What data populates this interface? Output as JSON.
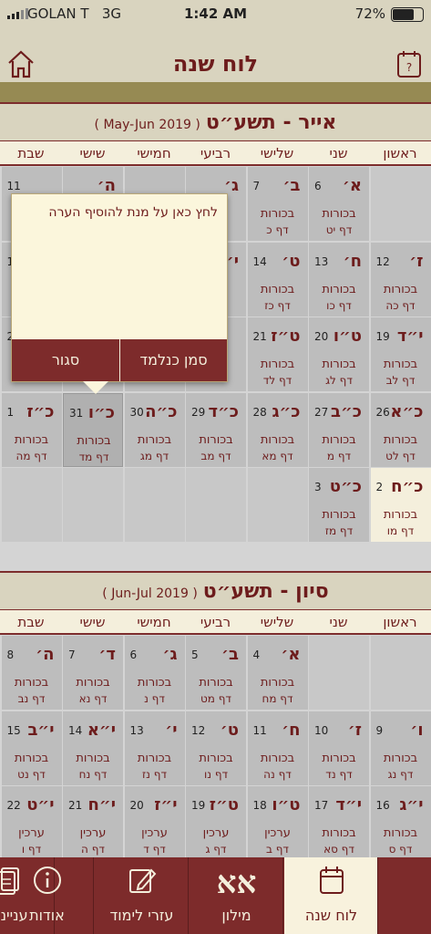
{
  "status": {
    "carrier": "GOLAN T",
    "network": "3G",
    "time": "1:42 AM",
    "battery": "72%"
  },
  "nav": {
    "title": "לוח שנה"
  },
  "weekdays": [
    "ראשון",
    "שני",
    "שלישי",
    "רביעי",
    "חמישי",
    "שישי",
    "שבת"
  ],
  "popup": {
    "hint": "לחץ כאן על מנת להוסיף הערה",
    "mark_label": "סמן כנלמד",
    "close_label": "סגור"
  },
  "months": [
    {
      "hebrew": "אייר - תשע״ט",
      "gregorian": "( May-Jun 2019 )",
      "weeks": [
        [
          null,
          {
            "h": "א׳",
            "g": "6",
            "t": "בכורות",
            "d": "דף יט"
          },
          {
            "h": "ב׳",
            "g": "7",
            "t": "בכורות",
            "d": "דף כ"
          },
          {
            "h": "ג׳",
            "g": "",
            "t": "",
            "d": ""
          },
          {
            "h": "",
            "g": "",
            "t": "",
            "d": ""
          },
          {
            "h": "ה׳",
            "g": "",
            "t": "",
            "d": ""
          },
          {
            "h": "",
            "g": "11",
            "t": "",
            "d": ""
          }
        ],
        [
          {
            "h": "ז׳",
            "g": "12",
            "t": "בכורות",
            "d": "דף כה"
          },
          {
            "h": "ח׳",
            "g": "13",
            "t": "בכורות",
            "d": "דף כו"
          },
          {
            "h": "ט׳",
            "g": "14",
            "t": "בכורות",
            "d": "דף כז"
          },
          {
            "h": "י׳",
            "g": "",
            "t": "",
            "d": ""
          },
          {
            "h": "",
            "g": "",
            "t": "",
            "d": ""
          },
          {
            "h": "",
            "g": "",
            "t": "",
            "d": ""
          },
          {
            "h": "",
            "g": "1",
            "t": "",
            "d": ""
          }
        ],
        [
          {
            "h": "י״ד",
            "g": "19",
            "t": "בכורות",
            "d": "דף לב"
          },
          {
            "h": "ט״ו",
            "g": "20",
            "t": "בכורות",
            "d": "דף לג"
          },
          {
            "h": "ט״ז",
            "g": "21",
            "t": "בכורות",
            "d": "דף לד"
          },
          {
            "h": "",
            "g": "",
            "t": "",
            "d": ""
          },
          {
            "h": "",
            "g": "",
            "t": "",
            "d": ""
          },
          {
            "h": "",
            "g": "",
            "t": "",
            "d": ""
          },
          {
            "h": "",
            "g": "2",
            "t": "",
            "d": ""
          }
        ],
        [
          {
            "h": "כ״א",
            "g": "26",
            "t": "בכורות",
            "d": "דף לט"
          },
          {
            "h": "כ״ב",
            "g": "27",
            "t": "בכורות",
            "d": "דף מ"
          },
          {
            "h": "כ״ג",
            "g": "28",
            "t": "בכורות",
            "d": "דף מא"
          },
          {
            "h": "כ״ד",
            "g": "29",
            "t": "בכורות",
            "d": "דף מב"
          },
          {
            "h": "כ״ה",
            "g": "30",
            "t": "בכורות",
            "d": "דף מג"
          },
          {
            "h": "כ״ו",
            "g": "31",
            "t": "בכורות",
            "d": "דף מד",
            "sel": true
          },
          {
            "h": "כ״ז",
            "g": "1",
            "t": "בכורות",
            "d": "דף מה"
          }
        ],
        [
          {
            "h": "כ״ח",
            "g": "2",
            "t": "בכורות",
            "d": "דף מו",
            "today": true
          },
          {
            "h": "כ״ט",
            "g": "3",
            "t": "בכורות",
            "d": "דף מז"
          },
          null,
          null,
          null,
          null,
          null
        ]
      ]
    },
    {
      "hebrew": "סיון - תשע״ט",
      "gregorian": "( Jun-Jul 2019 )",
      "weeks": [
        [
          null,
          null,
          {
            "h": "א׳",
            "g": "4",
            "t": "בכורות",
            "d": "דף מח"
          },
          {
            "h": "ב׳",
            "g": "5",
            "t": "בכורות",
            "d": "דף מט"
          },
          {
            "h": "ג׳",
            "g": "6",
            "t": "בכורות",
            "d": "דף נ"
          },
          {
            "h": "ד׳",
            "g": "7",
            "t": "בכורות",
            "d": "דף נא"
          },
          {
            "h": "ה׳",
            "g": "8",
            "t": "בכורות",
            "d": "דף נב"
          }
        ],
        [
          {
            "h": "ו׳",
            "g": "9",
            "t": "בכורות",
            "d": "דף נג"
          },
          {
            "h": "ז׳",
            "g": "10",
            "t": "בכורות",
            "d": "דף נד"
          },
          {
            "h": "ח׳",
            "g": "11",
            "t": "בכורות",
            "d": "דף נה"
          },
          {
            "h": "ט׳",
            "g": "12",
            "t": "בכורות",
            "d": "דף נו"
          },
          {
            "h": "י׳",
            "g": "13",
            "t": "בכורות",
            "d": "דף נז"
          },
          {
            "h": "י״א",
            "g": "14",
            "t": "בכורות",
            "d": "דף נח"
          },
          {
            "h": "י״ב",
            "g": "15",
            "t": "בכורות",
            "d": "דף נט"
          }
        ],
        [
          {
            "h": "י״ג",
            "g": "16",
            "t": "בכורות",
            "d": "דף ס"
          },
          {
            "h": "י״ד",
            "g": "17",
            "t": "בכורות",
            "d": "דף סא"
          },
          {
            "h": "ט״ו",
            "g": "18",
            "t": "ערכין",
            "d": "דף ב"
          },
          {
            "h": "ט״ז",
            "g": "19",
            "t": "ערכין",
            "d": "דף ג"
          },
          {
            "h": "י״ז",
            "g": "20",
            "t": "ערכין",
            "d": "דף ד"
          },
          {
            "h": "י״ח",
            "g": "21",
            "t": "ערכין",
            "d": "דף ה"
          },
          {
            "h": "י״ט",
            "g": "22",
            "t": "ערכין",
            "d": "דף ו"
          }
        ]
      ]
    }
  ],
  "tabs": [
    {
      "label": "עניינים",
      "icon": "book-icon"
    },
    {
      "label": "לוח שנה",
      "icon": "calendar-icon",
      "active": true
    },
    {
      "label": "מילון",
      "icon": "alef-icon",
      "glyph": "אא"
    },
    {
      "label": "עזרי לימוד",
      "icon": "pencil-icon"
    },
    {
      "label": "אודות",
      "icon": "info-icon",
      "glyph": "i"
    }
  ],
  "colors": {
    "accent": "#7d2b2b",
    "cream": "#f4efdc",
    "gold": "#968a53",
    "cell": "#bdbdbd"
  }
}
